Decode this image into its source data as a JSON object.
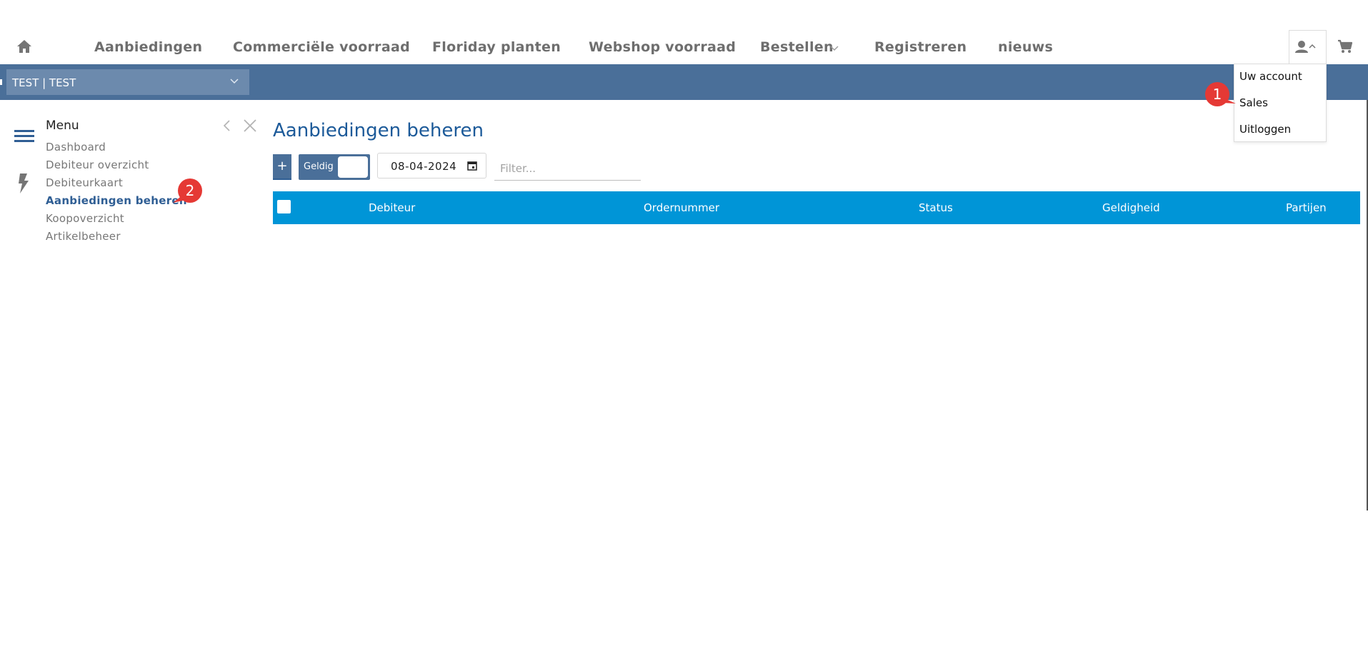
{
  "nav": {
    "items": [
      "Aanbiedingen",
      "Commerciële voorraad",
      "Floriday planten",
      "Webshop voorraad",
      "Bestellen",
      "Registreren",
      "nieuws"
    ],
    "icons": {
      "home": "home-icon",
      "user": "user-icon",
      "cart": "cart-icon"
    }
  },
  "customer_select": {
    "value": "TEST | TEST"
  },
  "user_menu": {
    "items": [
      "Uw account",
      "Sales",
      "Uitloggen"
    ]
  },
  "badges": [
    "1",
    "2"
  ],
  "sidebar": {
    "title": "Menu",
    "items": [
      "Dashboard",
      "Debiteur overzicht",
      "Debiteurkaart",
      "Aanbiedingen beheren",
      "Koopoverzicht",
      "Artikelbeheer"
    ],
    "active": "Aanbiedingen beheren"
  },
  "main": {
    "title": "Aanbiedingen beheren",
    "add_label": "+",
    "toggle_label": "Geldig",
    "date_value": "08-04-2024",
    "filter_placeholder": "Filter...",
    "columns": [
      "Debiteur",
      "Ordernummer",
      "Status",
      "Geldigheid",
      "Partijen"
    ]
  },
  "colors": {
    "brand_bar": "#4a6f99",
    "table_header": "#0095d7",
    "title": "#1c5a99",
    "badge": "#e53935"
  }
}
